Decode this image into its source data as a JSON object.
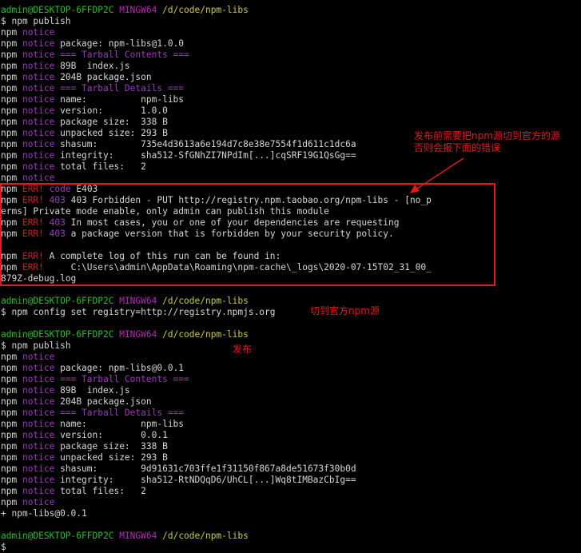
{
  "colors": {
    "background": "#000000",
    "text": "#d6d6d6",
    "prompt_user": "#23c123",
    "prompt_mingw": "#b629b6",
    "prompt_path": "#cbcb3f",
    "notice": "#9b3bb8",
    "error": "#c51f1f",
    "annotation": "#e21c1c"
  },
  "lines": [
    {
      "segs": [
        {
          "t": "admin@DESKTOP-6FFDP2C",
          "c": "user"
        },
        {
          "t": " ",
          "c": "normal"
        },
        {
          "t": "MINGW64",
          "c": "mingw"
        },
        {
          "t": " ",
          "c": "normal"
        },
        {
          "t": "/d/code/npm-libs",
          "c": "path"
        }
      ]
    },
    {
      "segs": [
        {
          "t": "$ npm publish",
          "c": "normal"
        }
      ]
    },
    {
      "segs": [
        {
          "t": "npm ",
          "c": "normal"
        },
        {
          "t": "notice",
          "c": "notice"
        }
      ]
    },
    {
      "segs": [
        {
          "t": "npm ",
          "c": "normal"
        },
        {
          "t": "notice",
          "c": "notice"
        },
        {
          "t": " package: npm-libs@1.0.0",
          "c": "normal"
        }
      ]
    },
    {
      "segs": [
        {
          "t": "npm ",
          "c": "normal"
        },
        {
          "t": "notice",
          "c": "notice"
        },
        {
          "t": " === Tarball Contents ===",
          "c": "tb"
        }
      ]
    },
    {
      "segs": [
        {
          "t": "npm ",
          "c": "normal"
        },
        {
          "t": "notice",
          "c": "notice"
        },
        {
          "t": " 89B  index.js",
          "c": "normal"
        }
      ]
    },
    {
      "segs": [
        {
          "t": "npm ",
          "c": "normal"
        },
        {
          "t": "notice",
          "c": "notice"
        },
        {
          "t": " 204B package.json",
          "c": "normal"
        }
      ]
    },
    {
      "segs": [
        {
          "t": "npm ",
          "c": "normal"
        },
        {
          "t": "notice",
          "c": "notice"
        },
        {
          "t": " === Tarball Details ===",
          "c": "tb"
        }
      ]
    },
    {
      "segs": [
        {
          "t": "npm ",
          "c": "normal"
        },
        {
          "t": "notice",
          "c": "notice"
        },
        {
          "t": " name:          npm-libs",
          "c": "normal"
        }
      ]
    },
    {
      "segs": [
        {
          "t": "npm ",
          "c": "normal"
        },
        {
          "t": "notice",
          "c": "notice"
        },
        {
          "t": " version:       1.0.0",
          "c": "normal"
        }
      ]
    },
    {
      "segs": [
        {
          "t": "npm ",
          "c": "normal"
        },
        {
          "t": "notice",
          "c": "notice"
        },
        {
          "t": " package size:  338 B",
          "c": "normal"
        }
      ]
    },
    {
      "segs": [
        {
          "t": "npm ",
          "c": "normal"
        },
        {
          "t": "notice",
          "c": "notice"
        },
        {
          "t": " unpacked size: 293 B",
          "c": "normal"
        }
      ]
    },
    {
      "segs": [
        {
          "t": "npm ",
          "c": "normal"
        },
        {
          "t": "notice",
          "c": "notice"
        },
        {
          "t": " shasum:        735e4d3613a6e194d7c8e38e7554f1d611c1dc6a",
          "c": "normal"
        }
      ]
    },
    {
      "segs": [
        {
          "t": "npm ",
          "c": "normal"
        },
        {
          "t": "notice",
          "c": "notice"
        },
        {
          "t": " integrity:     sha512-SfGNhZI7NPdIm[...]cqSRF19G1QsGg==",
          "c": "normal"
        }
      ]
    },
    {
      "segs": [
        {
          "t": "npm ",
          "c": "normal"
        },
        {
          "t": "notice",
          "c": "notice"
        },
        {
          "t": " total files:   2",
          "c": "normal"
        }
      ]
    },
    {
      "segs": [
        {
          "t": "npm ",
          "c": "normal"
        },
        {
          "t": "notice",
          "c": "notice"
        }
      ]
    },
    {
      "segs": [
        {
          "t": "npm ",
          "c": "normal"
        },
        {
          "t": "ERR!",
          "c": "err"
        },
        {
          "t": " ",
          "c": "normal"
        },
        {
          "t": "code",
          "c": "notice"
        },
        {
          "t": " E403",
          "c": "normal"
        }
      ]
    },
    {
      "segs": [
        {
          "t": "npm ",
          "c": "normal"
        },
        {
          "t": "ERR!",
          "c": "err"
        },
        {
          "t": " ",
          "c": "normal"
        },
        {
          "t": "403",
          "c": "notice"
        },
        {
          "t": " 403 Forbidden - PUT http://registry.npm.taobao.org/npm-libs - [no_p",
          "c": "normal"
        }
      ]
    },
    {
      "segs": [
        {
          "t": "erms] Private mode enable, only admin can publish this module",
          "c": "normal"
        }
      ]
    },
    {
      "segs": [
        {
          "t": "npm ",
          "c": "normal"
        },
        {
          "t": "ERR!",
          "c": "err"
        },
        {
          "t": " ",
          "c": "normal"
        },
        {
          "t": "403",
          "c": "notice"
        },
        {
          "t": " In most cases, you or one of your dependencies are requesting",
          "c": "normal"
        }
      ]
    },
    {
      "segs": [
        {
          "t": "npm ",
          "c": "normal"
        },
        {
          "t": "ERR!",
          "c": "err"
        },
        {
          "t": " ",
          "c": "normal"
        },
        {
          "t": "403",
          "c": "notice"
        },
        {
          "t": " a package version that is forbidden by your security policy.",
          "c": "normal"
        }
      ]
    },
    {
      "segs": [
        {
          "t": "",
          "c": "normal"
        }
      ]
    },
    {
      "segs": [
        {
          "t": "npm ",
          "c": "normal"
        },
        {
          "t": "ERR!",
          "c": "err"
        },
        {
          "t": " A complete log of this run can be found in:",
          "c": "normal"
        }
      ]
    },
    {
      "segs": [
        {
          "t": "npm ",
          "c": "normal"
        },
        {
          "t": "ERR!",
          "c": "err"
        },
        {
          "t": "     C:\\Users\\admin\\AppData\\Roaming\\npm-cache\\_logs\\2020-07-15T02_31_00_",
          "c": "normal"
        }
      ]
    },
    {
      "segs": [
        {
          "t": "879Z-debug.log",
          "c": "normal"
        }
      ]
    },
    {
      "segs": [
        {
          "t": "",
          "c": "normal"
        }
      ]
    },
    {
      "segs": [
        {
          "t": "admin@DESKTOP-6FFDP2C",
          "c": "user"
        },
        {
          "t": " ",
          "c": "normal"
        },
        {
          "t": "MINGW64",
          "c": "mingw"
        },
        {
          "t": " ",
          "c": "normal"
        },
        {
          "t": "/d/code/npm-libs",
          "c": "path"
        }
      ]
    },
    {
      "segs": [
        {
          "t": "$ npm config set registry=http://registry.npmjs.org",
          "c": "normal"
        }
      ]
    },
    {
      "segs": [
        {
          "t": "",
          "c": "normal"
        }
      ]
    },
    {
      "segs": [
        {
          "t": "admin@DESKTOP-6FFDP2C",
          "c": "user"
        },
        {
          "t": " ",
          "c": "normal"
        },
        {
          "t": "MINGW64",
          "c": "mingw"
        },
        {
          "t": " ",
          "c": "normal"
        },
        {
          "t": "/d/code/npm-libs",
          "c": "path"
        }
      ]
    },
    {
      "segs": [
        {
          "t": "$ npm publish",
          "c": "normal"
        }
      ]
    },
    {
      "segs": [
        {
          "t": "npm ",
          "c": "normal"
        },
        {
          "t": "notice",
          "c": "notice"
        }
      ]
    },
    {
      "segs": [
        {
          "t": "npm ",
          "c": "normal"
        },
        {
          "t": "notice",
          "c": "notice"
        },
        {
          "t": " package: npm-libs@0.0.1",
          "c": "normal"
        }
      ]
    },
    {
      "segs": [
        {
          "t": "npm ",
          "c": "normal"
        },
        {
          "t": "notice",
          "c": "notice"
        },
        {
          "t": " === Tarball Contents ===",
          "c": "tb"
        }
      ]
    },
    {
      "segs": [
        {
          "t": "npm ",
          "c": "normal"
        },
        {
          "t": "notice",
          "c": "notice"
        },
        {
          "t": " 89B  index.js",
          "c": "normal"
        }
      ]
    },
    {
      "segs": [
        {
          "t": "npm ",
          "c": "normal"
        },
        {
          "t": "notice",
          "c": "notice"
        },
        {
          "t": " 204B package.json",
          "c": "normal"
        }
      ]
    },
    {
      "segs": [
        {
          "t": "npm ",
          "c": "normal"
        },
        {
          "t": "notice",
          "c": "notice"
        },
        {
          "t": " === Tarball Details ===",
          "c": "tb"
        }
      ]
    },
    {
      "segs": [
        {
          "t": "npm ",
          "c": "normal"
        },
        {
          "t": "notice",
          "c": "notice"
        },
        {
          "t": " name:          npm-libs",
          "c": "normal"
        }
      ]
    },
    {
      "segs": [
        {
          "t": "npm ",
          "c": "normal"
        },
        {
          "t": "notice",
          "c": "notice"
        },
        {
          "t": " version:       0.0.1",
          "c": "normal"
        }
      ]
    },
    {
      "segs": [
        {
          "t": "npm ",
          "c": "normal"
        },
        {
          "t": "notice",
          "c": "notice"
        },
        {
          "t": " package size:  338 B",
          "c": "normal"
        }
      ]
    },
    {
      "segs": [
        {
          "t": "npm ",
          "c": "normal"
        },
        {
          "t": "notice",
          "c": "notice"
        },
        {
          "t": " unpacked size: 293 B",
          "c": "normal"
        }
      ]
    },
    {
      "segs": [
        {
          "t": "npm ",
          "c": "normal"
        },
        {
          "t": "notice",
          "c": "notice"
        },
        {
          "t": " shasum:        9d91631c703ffe1f31150f867a8de51673f30b0d",
          "c": "normal"
        }
      ]
    },
    {
      "segs": [
        {
          "t": "npm ",
          "c": "normal"
        },
        {
          "t": "notice",
          "c": "notice"
        },
        {
          "t": " integrity:     sha512-RtNDQqD6/UhCL[...]Wq8tIMBazCbIg==",
          "c": "normal"
        }
      ]
    },
    {
      "segs": [
        {
          "t": "npm ",
          "c": "normal"
        },
        {
          "t": "notice",
          "c": "notice"
        },
        {
          "t": " total files:   2",
          "c": "normal"
        }
      ]
    },
    {
      "segs": [
        {
          "t": "npm ",
          "c": "normal"
        },
        {
          "t": "notice",
          "c": "notice"
        }
      ]
    },
    {
      "segs": [
        {
          "t": "+ npm-libs@0.0.1",
          "c": "normal"
        }
      ]
    },
    {
      "segs": [
        {
          "t": "",
          "c": "normal"
        }
      ]
    },
    {
      "segs": [
        {
          "t": "admin@DESKTOP-6FFDP2C",
          "c": "user"
        },
        {
          "t": " ",
          "c": "normal"
        },
        {
          "t": "MINGW64",
          "c": "mingw"
        },
        {
          "t": " ",
          "c": "normal"
        },
        {
          "t": "/d/code/npm-libs",
          "c": "path"
        }
      ]
    },
    {
      "segs": [
        {
          "t": "$",
          "c": "normal"
        }
      ]
    }
  ],
  "annotations": {
    "switch_note": "发布前需要把npm源切到官方的源\n否则会报下面的错误",
    "switch_registry": "切到官方npm源",
    "publish": "发布"
  }
}
